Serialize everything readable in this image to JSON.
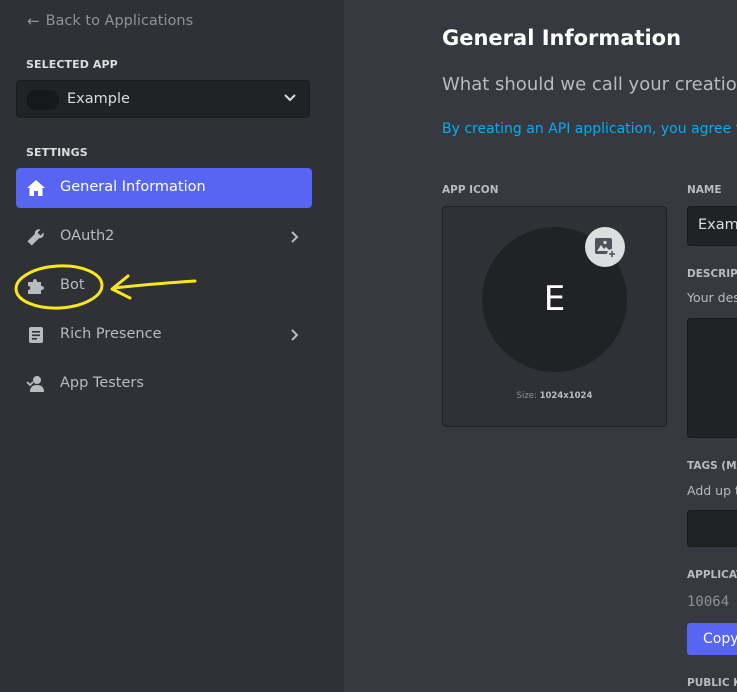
{
  "sidebar": {
    "back_label": "Back to Applications",
    "selected_app_heading": "SELECTED APP",
    "selected_app_name": "Example",
    "settings_heading": "SETTINGS",
    "items": [
      {
        "label": "General Information",
        "icon": "home-icon",
        "active": true
      },
      {
        "label": "OAuth2",
        "icon": "wrench-icon",
        "has_chevron": true
      },
      {
        "label": "Bot",
        "icon": "puzzle-icon"
      },
      {
        "label": "Rich Presence",
        "icon": "document-icon",
        "has_chevron": true
      },
      {
        "label": "App Testers",
        "icon": "person-icon"
      }
    ]
  },
  "main": {
    "title": "General Information",
    "subtitle": "What should we call your creation?",
    "tos_link": "By creating an API application, you agree to t",
    "app_icon_label": "APP ICON",
    "icon_letter": "E",
    "size_prefix": "Size: ",
    "size_value": "1024x1024",
    "name_label": "NAME",
    "name_value": "Examp",
    "description_label": "DESCRIPT",
    "description_helper": "Your des",
    "tags_label": "TAGS (MA",
    "tags_helper": "Add up t",
    "application_id_label": "APPLICAT",
    "application_id_value": "10064",
    "copy_label": "Copy",
    "public_key_label": "PUBLIC KE"
  },
  "colors": {
    "accent": "#5865f2",
    "link": "#00aff4",
    "annotation": "#f8e71c"
  }
}
